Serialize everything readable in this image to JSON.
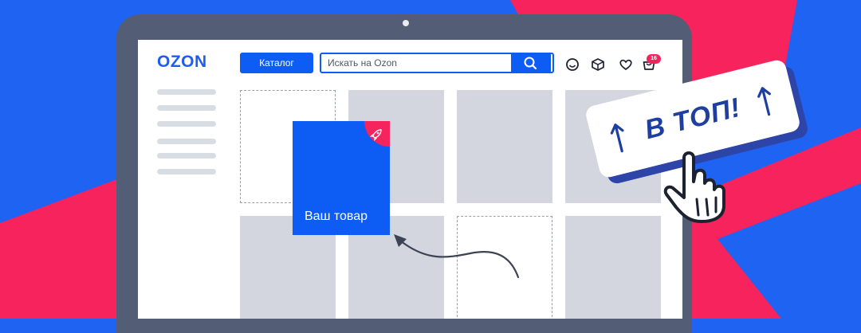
{
  "header": {
    "logo": "OZON",
    "catalog_label": "Каталог",
    "search_placeholder": "Искать на Ozon",
    "cart_badge": "16",
    "icons": [
      "smile-icon",
      "box-icon",
      "heart-icon",
      "cart-icon",
      "search-icon"
    ]
  },
  "product": {
    "label": "Ваш товар",
    "icon": "rocket-icon"
  },
  "promo_button": {
    "label": "В ТОП!"
  },
  "colors": {
    "background_blue": "#1f63f3",
    "background_pink": "#f6235c",
    "brand_blue": "#0d5df4",
    "laptop_frame": "#535d75",
    "placeholder_gray": "#d3d6de"
  }
}
